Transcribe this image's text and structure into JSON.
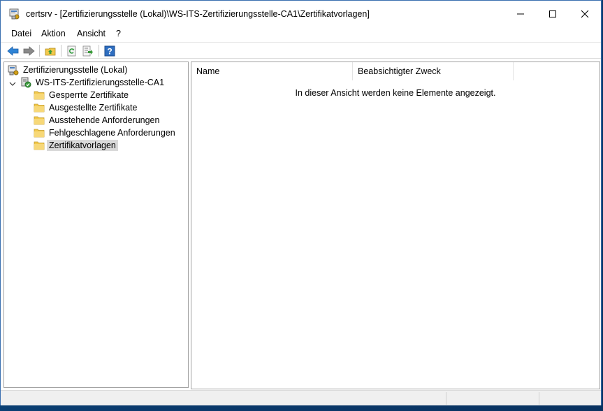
{
  "window": {
    "title": "certsrv - [Zertifizierungsstelle (Lokal)\\WS-ITS-Zertifizierungsstelle-CA1\\Zertifikatvorlagen]",
    "icons": {
      "app": "certsrv-icon",
      "minimize": "minimize-icon",
      "maximize": "maximize-icon",
      "close": "close-icon"
    }
  },
  "menu": {
    "items": [
      "Datei",
      "Aktion",
      "Ansicht",
      "?"
    ]
  },
  "toolbar": {
    "buttons": [
      "back-arrow-icon",
      "forward-arrow-icon",
      "up-folder-icon",
      "refresh-icon",
      "export-list-icon",
      "help-icon"
    ]
  },
  "tree": {
    "root": "Zertifizierungsstelle (Lokal)",
    "ca": "WS-ITS-Zertifizierungsstelle-CA1",
    "folders": [
      "Gesperrte Zertifikate",
      "Ausgestellte Zertifikate",
      "Ausstehende Anforderungen",
      "Fehlgeschlagene Anforderungen",
      "Zertifikatvorlagen"
    ],
    "selected_index": 4
  },
  "list": {
    "columns": [
      "Name",
      "Beabsichtigter Zweck"
    ],
    "empty_message": "In dieser Ansicht werden keine Elemente angezeigt."
  },
  "colors": {
    "folder": "#f2c94c",
    "selection": "#d9d9d9",
    "accent_blue": "#2f6fc1",
    "green": "#3a9b3a"
  }
}
